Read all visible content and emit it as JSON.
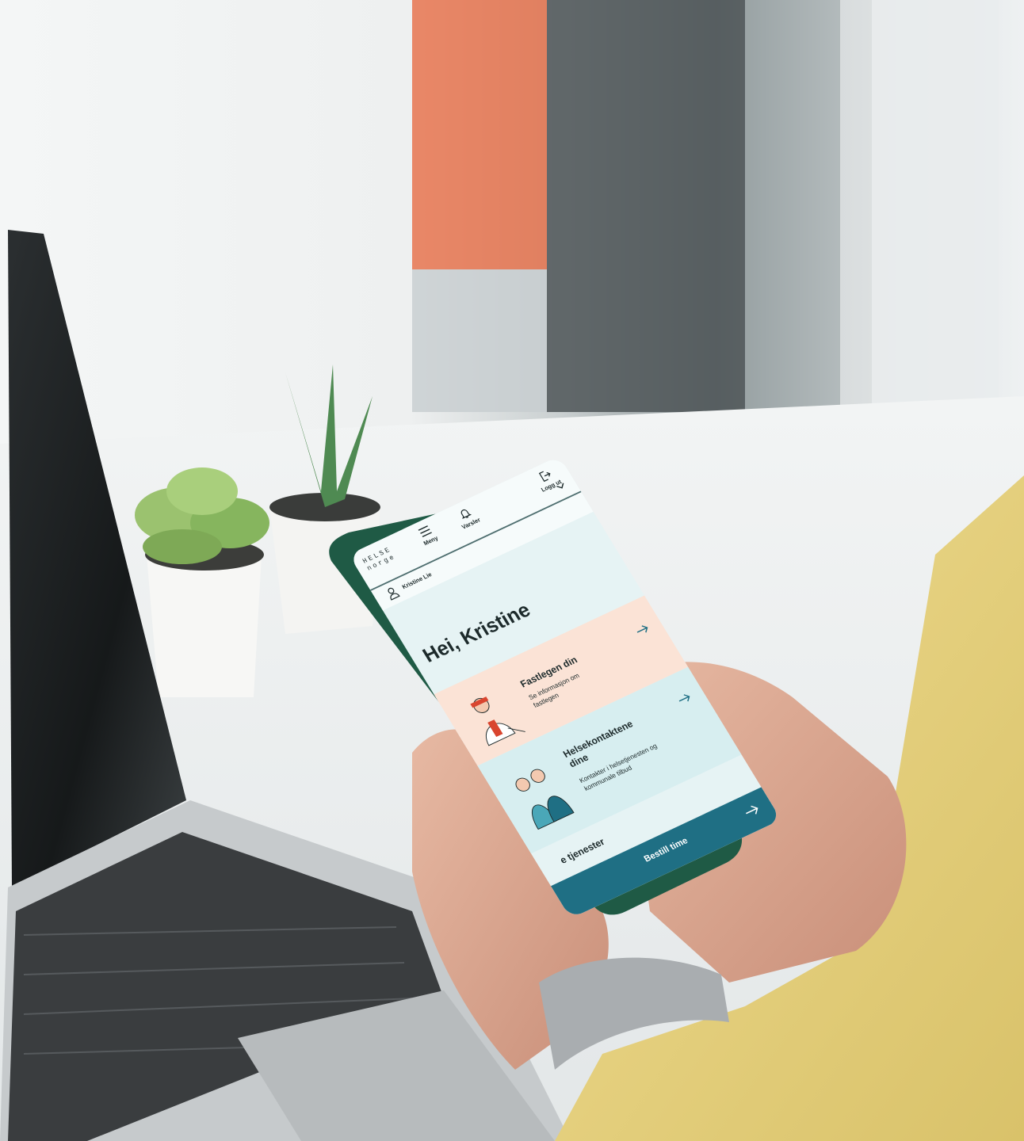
{
  "app": {
    "logo_line1": "HELSE",
    "logo_line2": "norge",
    "nav": {
      "menu_label": "Meny",
      "alerts_label": "Varsler",
      "logout_label": "Logg ut"
    },
    "user_name": "Kristine Lie",
    "greeting": "Hei, Kristine",
    "cards": [
      {
        "title": "Fastlegen din",
        "subtitle": "Se informasjon om fastlegen"
      },
      {
        "title": "Helsekontaktene dine",
        "subtitle": "Kontakter i helsetjenesten og kommunale tilbud"
      }
    ],
    "services_heading": "e tjenester",
    "cta_label": "Bestill time"
  },
  "colors": {
    "phone_case": "#1f5a45",
    "screen_bg": "#e6f3f4",
    "card_peach": "#fbe3d6",
    "card_teal": "#d7eef0",
    "cta_blue": "#1f6f84"
  }
}
